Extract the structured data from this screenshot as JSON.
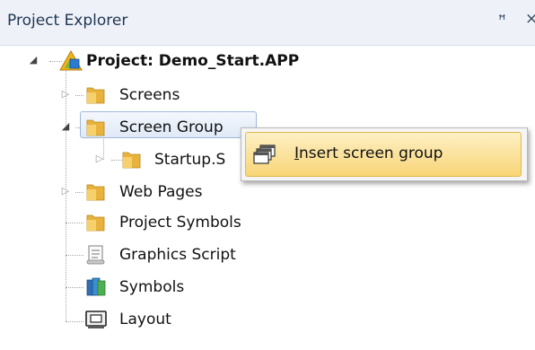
{
  "panel": {
    "title": "Project Explorer",
    "pin_glyph": "ꟸ",
    "close_glyph": "×"
  },
  "tree": {
    "root": {
      "label": "Project: Demo_Start.APP",
      "icon": "project-icon",
      "expanded": true
    },
    "items": [
      {
        "label": "Screens",
        "icon": "folder-icon",
        "expanded": false,
        "has_children": true
      },
      {
        "label": "Screen Group",
        "icon": "folder-icon",
        "expanded": true,
        "has_children": true,
        "selected": true,
        "children": [
          {
            "label": "Startup.S",
            "icon": "folder-icon",
            "expanded": false,
            "has_children": true
          }
        ]
      },
      {
        "label": "Web Pages",
        "icon": "folder-icon",
        "expanded": false,
        "has_children": true
      },
      {
        "label": "Project Symbols",
        "icon": "folder-icon",
        "has_children": false
      },
      {
        "label": "Graphics Script",
        "icon": "script-icon",
        "has_children": false
      },
      {
        "label": "Symbols",
        "icon": "symbols-icon",
        "has_children": false
      },
      {
        "label": "Layout",
        "icon": "layout-icon",
        "has_children": false
      }
    ]
  },
  "context_menu": {
    "items": [
      {
        "label": "Insert screen group",
        "mnemonic": "I",
        "icon": "windows-stack-icon",
        "highlighted": true
      }
    ]
  },
  "colors": {
    "folder": "#f0c24a",
    "selection_border": "#9fb7d8",
    "menu_highlight": "#f8d576"
  }
}
